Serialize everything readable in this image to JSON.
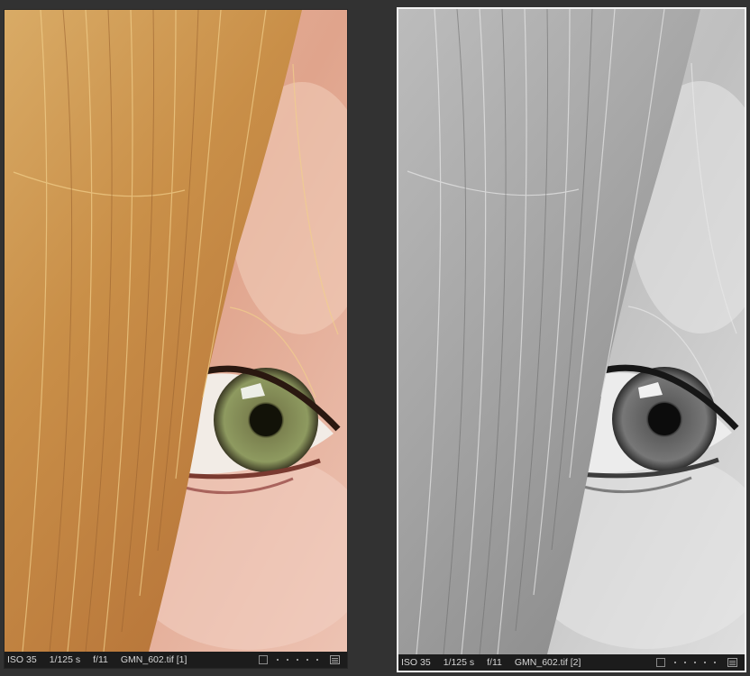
{
  "colors": {
    "background": "#323232",
    "selected_border": "#f2f2f2",
    "status_bar": "#1c1c1c",
    "status_text": "#d6d6d6"
  },
  "panels": [
    {
      "iso": "ISO 35",
      "shutter": "1/125 s",
      "aperture": "f/11",
      "filename": "GMN_602.tif [1]",
      "mode": "color",
      "selected": false
    },
    {
      "iso": "ISO 35",
      "shutter": "1/125 s",
      "aperture": "f/11",
      "filename": "GMN_602.tif [2]",
      "mode": "grayscale",
      "selected": true
    }
  ],
  "status_icons": [
    "flag-box-icon",
    "rating-dots-icon",
    "menu-icon"
  ]
}
